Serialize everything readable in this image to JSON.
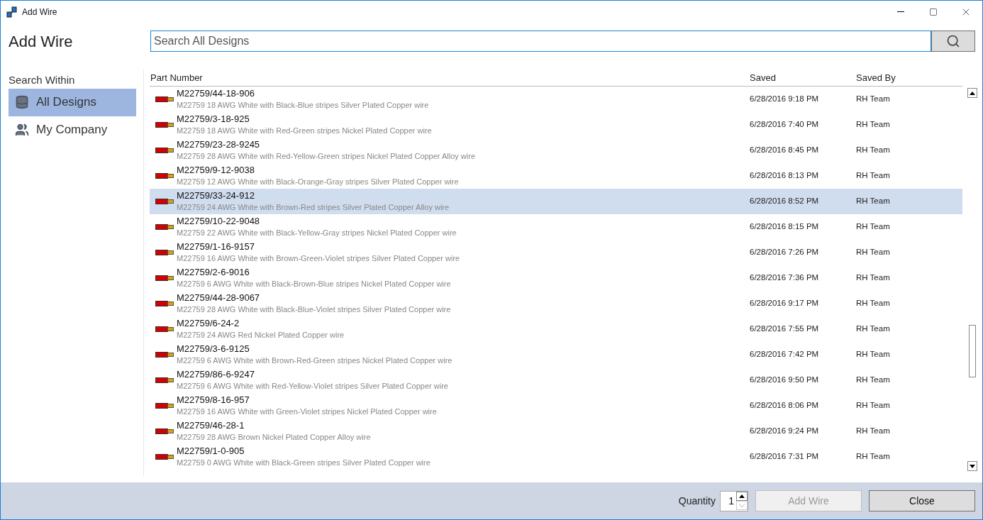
{
  "window": {
    "title": "Add Wire"
  },
  "heading": "Add Wire",
  "search": {
    "placeholder": "Search All Designs"
  },
  "sidebar": {
    "title": "Search Within",
    "items": [
      {
        "label": "All Designs",
        "kind": "database",
        "selected": true
      },
      {
        "label": "My Company",
        "kind": "people",
        "selected": false
      }
    ]
  },
  "table": {
    "columns": [
      "Part Number",
      "Saved",
      "Saved By"
    ],
    "rows": [
      {
        "part": "M22759/44-18-906",
        "description": "M22759 18 AWG White with Black-Blue stripes Silver Plated Copper wire",
        "saved": "6/28/2016 9:18 PM",
        "saved_by": "RH Team",
        "selected": false
      },
      {
        "part": "M22759/3-18-925",
        "description": "M22759 18 AWG White with Red-Green stripes Nickel Plated Copper wire",
        "saved": "6/28/2016 7:40 PM",
        "saved_by": "RH Team",
        "selected": false
      },
      {
        "part": "M22759/23-28-9245",
        "description": "M22759 28 AWG White with Red-Yellow-Green stripes Nickel Plated Copper Alloy wire",
        "saved": "6/28/2016 8:45 PM",
        "saved_by": "RH Team",
        "selected": false
      },
      {
        "part": "M22759/9-12-9038",
        "description": "M22759 12 AWG White with Black-Orange-Gray stripes Silver Plated Copper wire",
        "saved": "6/28/2016 8:13 PM",
        "saved_by": "RH Team",
        "selected": false
      },
      {
        "part": "M22759/33-24-912",
        "description": "M22759 24 AWG White with Brown-Red stripes Silver Plated Copper Alloy wire",
        "saved": "6/28/2016 8:52 PM",
        "saved_by": "RH Team",
        "selected": true
      },
      {
        "part": "M22759/10-22-9048",
        "description": "M22759 22 AWG White with Black-Yellow-Gray stripes Nickel Plated Copper wire",
        "saved": "6/28/2016 8:15 PM",
        "saved_by": "RH Team",
        "selected": false
      },
      {
        "part": "M22759/1-16-9157",
        "description": "M22759 16 AWG White with Brown-Green-Violet stripes Silver Plated Copper wire",
        "saved": "6/28/2016 7:26 PM",
        "saved_by": "RH Team",
        "selected": false
      },
      {
        "part": "M22759/2-6-9016",
        "description": "M22759 6 AWG White with Black-Brown-Blue stripes Nickel Plated Copper wire",
        "saved": "6/28/2016 7:36 PM",
        "saved_by": "RH Team",
        "selected": false
      },
      {
        "part": "M22759/44-28-9067",
        "description": "M22759 28 AWG White with Black-Blue-Violet stripes Silver Plated Copper wire",
        "saved": "6/28/2016 9:17 PM",
        "saved_by": "RH Team",
        "selected": false
      },
      {
        "part": "M22759/6-24-2",
        "description": "M22759 24 AWG Red Nickel Plated Copper wire",
        "saved": "6/28/2016 7:55 PM",
        "saved_by": "RH Team",
        "selected": false
      },
      {
        "part": "M22759/3-6-9125",
        "description": "M22759 6 AWG White with Brown-Red-Green stripes Nickel Plated Copper wire",
        "saved": "6/28/2016 7:42 PM",
        "saved_by": "RH Team",
        "selected": false
      },
      {
        "part": "M22759/86-6-9247",
        "description": "M22759 6 AWG White with Red-Yellow-Violet stripes Silver Plated Copper wire",
        "saved": "6/28/2016 9:50 PM",
        "saved_by": "RH Team",
        "selected": false
      },
      {
        "part": "M22759/8-16-957",
        "description": "M22759 16 AWG White with Green-Violet stripes Nickel Plated Copper wire",
        "saved": "6/28/2016 8:06 PM",
        "saved_by": "RH Team",
        "selected": false
      },
      {
        "part": "M22759/46-28-1",
        "description": "M22759 28 AWG Brown Nickel Plated Copper Alloy wire",
        "saved": "6/28/2016 9:24 PM",
        "saved_by": "RH Team",
        "selected": false
      },
      {
        "part": "M22759/1-0-905",
        "description": "M22759 0 AWG White with Black-Green stripes Silver Plated Copper wire",
        "saved": "6/28/2016 7:31 PM",
        "saved_by": "RH Team",
        "selected": false
      }
    ]
  },
  "footer": {
    "quantity_label": "Quantity",
    "quantity": "1",
    "quantity_down_disabled": true,
    "buttons": [
      {
        "label": "Add Wire",
        "disabled": true
      },
      {
        "label": "Close",
        "disabled": false
      }
    ]
  }
}
